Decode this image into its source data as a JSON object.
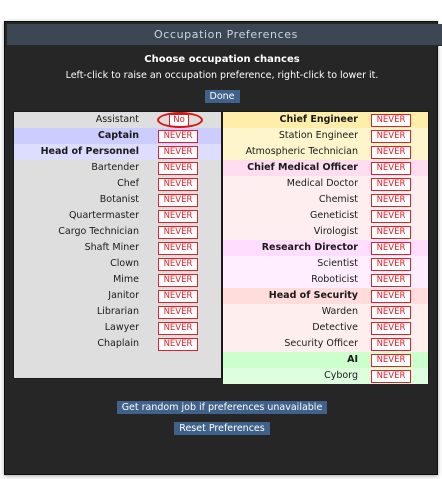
{
  "window": {
    "title": "Occupation Preferences"
  },
  "header": {
    "title": "Choose occupation chances",
    "subtitle": "Left-click to raise an occupation preference, right-click to lower it.",
    "done_label": "Done"
  },
  "colors": {
    "assistant": "#dedede",
    "command_head": "#ccccff",
    "command": "#ddddff",
    "civilian": "#dedede",
    "engineering_head": "#ffeeaa",
    "engineering": "#fff5cc",
    "medical_head": "#ffddf0",
    "medical": "#ffeef0",
    "science_head": "#ffddff",
    "science": "#ffeeff",
    "security_head": "#ffdddd",
    "security": "#ffeeee",
    "silicon_head": "#ccffcc",
    "silicon": "#ddffdd",
    "pref_red": "#e0202a"
  },
  "left_jobs": [
    {
      "name": "Assistant",
      "pref": "No",
      "head": false,
      "group": "assistant",
      "highlight": true
    },
    {
      "name": "Captain",
      "pref": "NEVER",
      "head": true,
      "group": "command_head"
    },
    {
      "name": "Head of Personnel",
      "pref": "NEVER",
      "head": true,
      "group": "command"
    },
    {
      "name": "Bartender",
      "pref": "NEVER",
      "head": false,
      "group": "civilian"
    },
    {
      "name": "Chef",
      "pref": "NEVER",
      "head": false,
      "group": "civilian"
    },
    {
      "name": "Botanist",
      "pref": "NEVER",
      "head": false,
      "group": "civilian"
    },
    {
      "name": "Quartermaster",
      "pref": "NEVER",
      "head": false,
      "group": "civilian"
    },
    {
      "name": "Cargo Technician",
      "pref": "NEVER",
      "head": false,
      "group": "civilian"
    },
    {
      "name": "Shaft Miner",
      "pref": "NEVER",
      "head": false,
      "group": "civilian"
    },
    {
      "name": "Clown",
      "pref": "NEVER",
      "head": false,
      "group": "civilian"
    },
    {
      "name": "Mime",
      "pref": "NEVER",
      "head": false,
      "group": "civilian"
    },
    {
      "name": "Janitor",
      "pref": "NEVER",
      "head": false,
      "group": "civilian"
    },
    {
      "name": "Librarian",
      "pref": "NEVER",
      "head": false,
      "group": "civilian"
    },
    {
      "name": "Lawyer",
      "pref": "NEVER",
      "head": false,
      "group": "civilian"
    },
    {
      "name": "Chaplain",
      "pref": "NEVER",
      "head": false,
      "group": "civilian"
    }
  ],
  "right_jobs": [
    {
      "name": "Chief Engineer",
      "pref": "NEVER",
      "head": true,
      "group": "engineering_head"
    },
    {
      "name": "Station Engineer",
      "pref": "NEVER",
      "head": false,
      "group": "engineering"
    },
    {
      "name": "Atmospheric Technician",
      "pref": "NEVER",
      "head": false,
      "group": "engineering"
    },
    {
      "name": "Chief Medical Officer",
      "pref": "NEVER",
      "head": true,
      "group": "medical_head"
    },
    {
      "name": "Medical Doctor",
      "pref": "NEVER",
      "head": false,
      "group": "medical"
    },
    {
      "name": "Chemist",
      "pref": "NEVER",
      "head": false,
      "group": "medical"
    },
    {
      "name": "Geneticist",
      "pref": "NEVER",
      "head": false,
      "group": "medical"
    },
    {
      "name": "Virologist",
      "pref": "NEVER",
      "head": false,
      "group": "medical"
    },
    {
      "name": "Research Director",
      "pref": "NEVER",
      "head": true,
      "group": "science_head"
    },
    {
      "name": "Scientist",
      "pref": "NEVER",
      "head": false,
      "group": "science"
    },
    {
      "name": "Roboticist",
      "pref": "NEVER",
      "head": false,
      "group": "science"
    },
    {
      "name": "Head of Security",
      "pref": "NEVER",
      "head": true,
      "group": "security_head"
    },
    {
      "name": "Warden",
      "pref": "NEVER",
      "head": false,
      "group": "security"
    },
    {
      "name": "Detective",
      "pref": "NEVER",
      "head": false,
      "group": "security"
    },
    {
      "name": "Security Officer",
      "pref": "NEVER",
      "head": false,
      "group": "security"
    },
    {
      "name": "AI",
      "pref": "NEVER",
      "head": true,
      "group": "silicon_head"
    },
    {
      "name": "Cyborg",
      "pref": "NEVER",
      "head": false,
      "group": "silicon"
    }
  ],
  "footer": {
    "random_label": "Get random job if preferences unavailable",
    "reset_label": "Reset Preferences"
  }
}
